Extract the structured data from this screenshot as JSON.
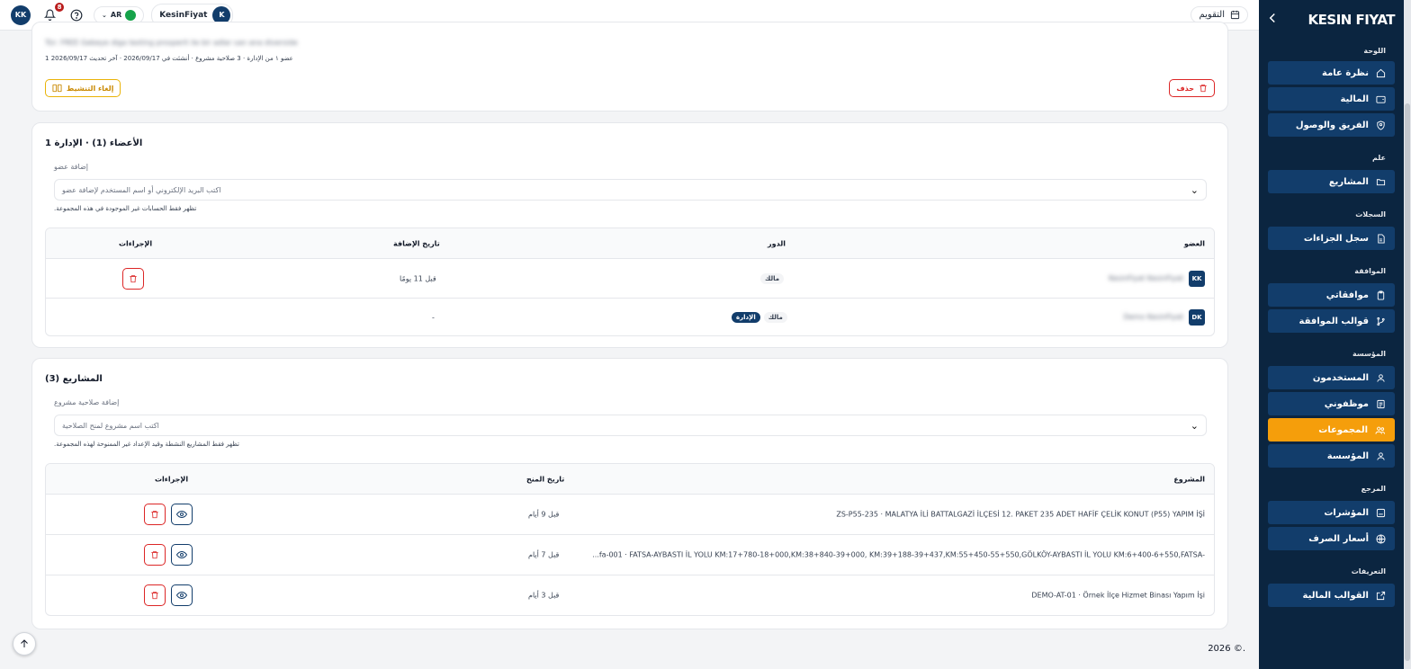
{
  "topbar": {
    "user_initials": "KK",
    "notifications_count": "8",
    "lang": "AR",
    "org_name": "KesinFiyat",
    "org_initial": "K",
    "calendar_label": "التقويم"
  },
  "sidebar": {
    "logo": "KESIN FIYAT",
    "sections": {
      "dashboard": "اللوحة",
      "work": "علم",
      "records": "السجلات",
      "approval": "الموافقة",
      "organization": "المؤسسة",
      "reference": "المرجع",
      "definitions": "التعريفات"
    },
    "items": {
      "overview": "نظرة عامة",
      "finance": "المالية",
      "team": "الفريق والوصول",
      "projects": "المشاريع",
      "penalties": "سجل الجزاءات",
      "my_approvals": "موافقاتي",
      "approval_templates": "قوالب الموافقة",
      "users": "المستخدمون",
      "employees": "موظفوني",
      "groups": "المجموعات",
      "institution": "المؤسسة",
      "indicators": "المؤشرات",
      "exchange": "أسعار الصرف",
      "finance_templates": "القوالب المالية"
    }
  },
  "group": {
    "description_blurred": "Tür: FREE  Gebeye diga testing prosperit ile bir adlar san ana diverside",
    "meta": "عضو ١ من الإدارة · 3 صلاحية مشروع · أنشئت في 2026/09/17 · آخر تحديث 2026/09/17 1",
    "delete_label": "حذف",
    "deactivate_label": "إلغاء التنشيط"
  },
  "members": {
    "title": "الأعضاء (1) · الإدارة 1",
    "add_label": "إضافة عضو",
    "add_placeholder": "اكتب البريد الإلكتروني أو اسم المستخدم لإضافة عضو",
    "hint": "تظهر فقط الحسابات غير الموجودة في هذه المجموعة.",
    "columns": {
      "member": "العضو",
      "role": "الدور",
      "added": "تاريخ الإضافة",
      "actions": "الإجراءات"
    },
    "rows": [
      {
        "initials": "KK",
        "name_blurred": "KesinFiyat KesinFiyat",
        "role": "مالك",
        "badge": "",
        "added": "قبل 11 يومًا"
      },
      {
        "initials": "DK",
        "name_blurred": "Demo KesinFiyat",
        "role": "مالك",
        "badge": "الإدارة",
        "added": "-"
      }
    ]
  },
  "projects": {
    "title": "المشاريع (3)",
    "add_label": "إضافة صلاحية مشروع",
    "add_placeholder": "اكتب اسم مشروع لمنح الصلاحية",
    "hint": "تظهر فقط المشاريع النشطة وقيد الإعداد غير الممنوحة لهذه المجموعة.",
    "columns": {
      "project": "المشروع",
      "granted": "تاريخ المنح",
      "actions": "الإجراءات"
    },
    "rows": [
      {
        "name": "ZS-P55-235 · MALATYA İLİ BATTALGAZİ İLÇESİ 12. PAKET 235 ADET HAFİF ÇELİK KONUT (P55) YAPIM İŞİ",
        "granted": "قبل 9 أيام"
      },
      {
        "name": "...fa-001 · FATSA-AYBASTI İL YOLU KM:17+780-18+000,KM:38+840-39+000, KM:39+188-39+437,KM:55+450-55+550,GÖLKÖY-AYBASTI İL YOLU KM:6+400-6+550,FATSA-",
        "granted": "قبل 7 أيام"
      },
      {
        "name": "DEMO-AT-01 · Örnek İlçe Hizmet Binası Yapım İşi",
        "granted": "قبل 3 أيام"
      }
    ]
  },
  "footer": {
    "copyright": "2026 ©."
  }
}
